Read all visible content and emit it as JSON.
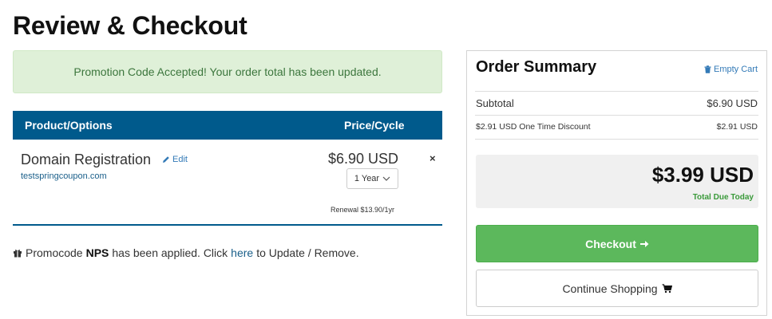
{
  "page": {
    "title": "Review & Checkout"
  },
  "alert": {
    "message": "Promotion Code Accepted! Your order total has been updated."
  },
  "cart": {
    "headers": {
      "product": "Product/Options",
      "price": "Price/Cycle"
    },
    "item": {
      "name": "Domain Registration",
      "edit_label": "Edit",
      "domain": "testspringcoupon.com",
      "price": "$6.90 USD",
      "cycle": "1 Year",
      "renewal": "Renewal $13.90/1yr",
      "remove_label": "×"
    }
  },
  "promo": {
    "prefix": "Promocode",
    "code": "NPS",
    "middle": "has been applied. Click",
    "link": "here",
    "suffix": "to Update / Remove."
  },
  "summary": {
    "title": "Order Summary",
    "empty_cart": "Empty Cart",
    "subtotal_label": "Subtotal",
    "subtotal_value": "$6.90 USD",
    "discount_label": "$2.91 USD One Time Discount",
    "discount_value": "$2.91 USD",
    "total_amount": "$3.99 USD",
    "total_label": "Total Due Today",
    "checkout_label": "Checkout",
    "continue_label": "Continue Shopping"
  },
  "colors": {
    "header_bg": "#005a8c",
    "checkout_green": "#5cb85c",
    "alert_bg": "#dff0d8",
    "link_blue": "#337ab7"
  },
  "icons": {
    "edit": "pencil-icon",
    "remove": "close-icon",
    "select": "chevron-down-icon",
    "gift": "gift-icon",
    "trash": "trash-icon",
    "arrow": "arrow-right-icon",
    "cart": "cart-icon"
  }
}
